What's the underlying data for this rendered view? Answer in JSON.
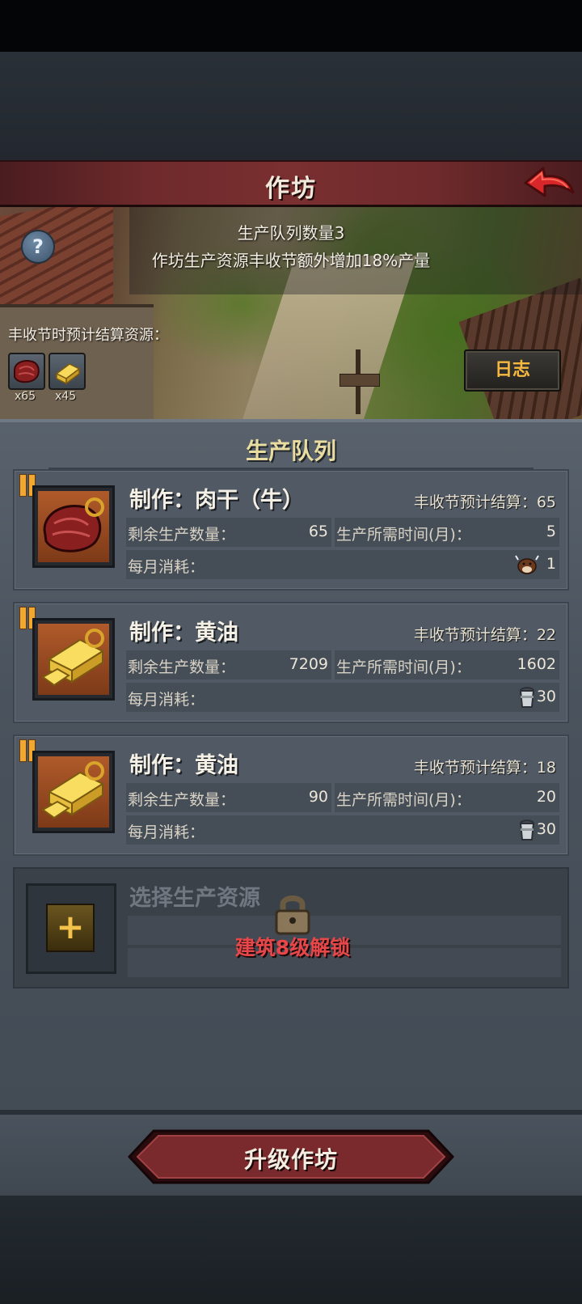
{
  "header": {
    "title": "作坊"
  },
  "info": {
    "queue_count": "生产队列数量3",
    "bonus": "作坊生产资源丰收节额外增加18%产量",
    "resources_label": "丰收节时预计结算资源：",
    "resources": [
      {
        "icon": "beef-jerky-icon",
        "count": "x65"
      },
      {
        "icon": "butter-icon",
        "count": "x45"
      }
    ],
    "log_button": "日志"
  },
  "queue": {
    "title": "生产队列",
    "items": [
      {
        "title": "制作：肉干（牛）",
        "harvest": "丰收节预计结算：65",
        "remaining_label": "剩余生产数量：",
        "remaining": "65",
        "time_label": "生产所需时间(月)：",
        "time": "5",
        "consumption_label": "每月消耗：",
        "consumption_icon": "cow-icon",
        "consumption": "1"
      },
      {
        "title": "制作：黄油",
        "harvest": "丰收节预计结算：22",
        "remaining_label": "剩余生产数量：",
        "remaining": "7209",
        "time_label": "生产所需时间(月)：",
        "time": "1602",
        "consumption_label": "每月消耗：",
        "consumption_icon": "milk-pail-icon",
        "consumption": "30"
      },
      {
        "title": "制作：黄油",
        "harvest": "丰收节预计结算：18",
        "remaining_label": "剩余生产数量：",
        "remaining": "90",
        "time_label": "生产所需时间(月)：",
        "time": "20",
        "consumption_label": "每月消耗：",
        "consumption_icon": "milk-pail-icon",
        "consumption": "30"
      }
    ],
    "locked": {
      "title": "选择生产资源",
      "unlock_text": "建筑8级解锁"
    }
  },
  "footer": {
    "upgrade_button": "升级作坊"
  },
  "colors": {
    "accent_gold": "#f7b840",
    "unlock_red": "#e8474a",
    "header_red": "#7a2f30"
  }
}
